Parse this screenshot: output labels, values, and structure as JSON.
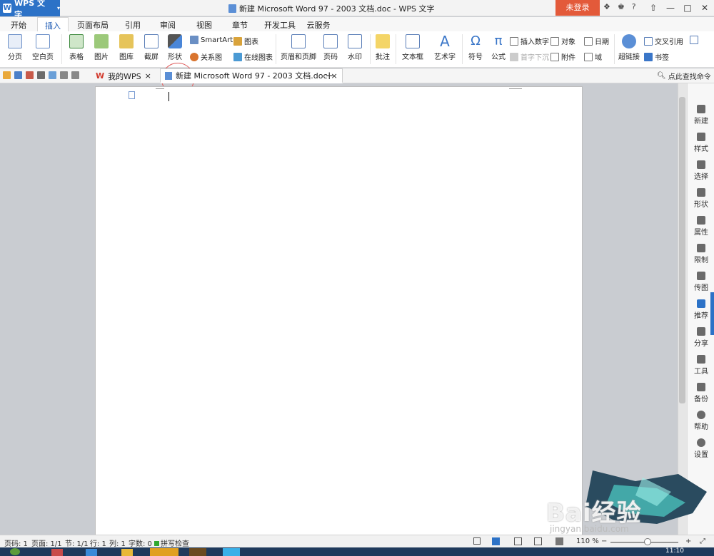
{
  "app": {
    "name": "WPS 文字",
    "logo_letter": "W"
  },
  "window": {
    "title": "新建 Microsoft Word 97 - 2003 文档.doc - WPS 文字",
    "login_label": "未登录",
    "brand_color": "#2c72c7",
    "login_color": "#e35a3a"
  },
  "menu_tabs": [
    "开始",
    "插入",
    "页面布局",
    "引用",
    "审阅",
    "视图",
    "章节",
    "开发工具",
    "云服务"
  ],
  "active_tab": "插入",
  "ribbon": {
    "fenye": "分页",
    "kongbaiye": "空白页",
    "biaoge": "表格",
    "tupian": "图片",
    "tuku": "图库",
    "jieping": "截屏",
    "xingzhuang": "形状",
    "smartart": "SmartArt",
    "tubiao": "图表",
    "guanxitu": "关系图",
    "zaixiantubiao": "在线图表",
    "yemei": "页眉和页脚",
    "yema": "页码",
    "shuiyin": "水印",
    "pizhu": "批注",
    "wenbenkuang": "文本框",
    "yishuzi": "艺术字",
    "fuhao": "符号",
    "gongshi": "公式",
    "charushuzi": "插入数字",
    "duixiang": "对象",
    "riqi": "日期",
    "shouzixiachen": "首字下沉",
    "fujian": "附件",
    "yu": "域",
    "chaolianjie": "超链接",
    "jiaochayinyong": "交叉引用",
    "shuqian": "书签"
  },
  "doc_tabs": [
    {
      "label": "我的WPS"
    },
    {
      "label": "新建 Microsoft Word 97 - 2003 文档.doc"
    }
  ],
  "search_cmd": "点此查找命令",
  "right_panel": [
    "新建",
    "样式",
    "选择",
    "形状",
    "属性",
    "限制",
    "传图",
    "推荐",
    "分享",
    "工具",
    "备份",
    "帮助",
    "设置"
  ],
  "status": {
    "page": "页码: 1",
    "pages": "页面: 1/1",
    "section": "节: 1/1",
    "row": "行: 1",
    "col": "列: 1",
    "words": "字数: 0",
    "spell": "拼写检查",
    "zoom": "110 %"
  },
  "watermark": {
    "text": "Bai经验",
    "url": "jingyan.baidu.com"
  },
  "clock": "11:10"
}
